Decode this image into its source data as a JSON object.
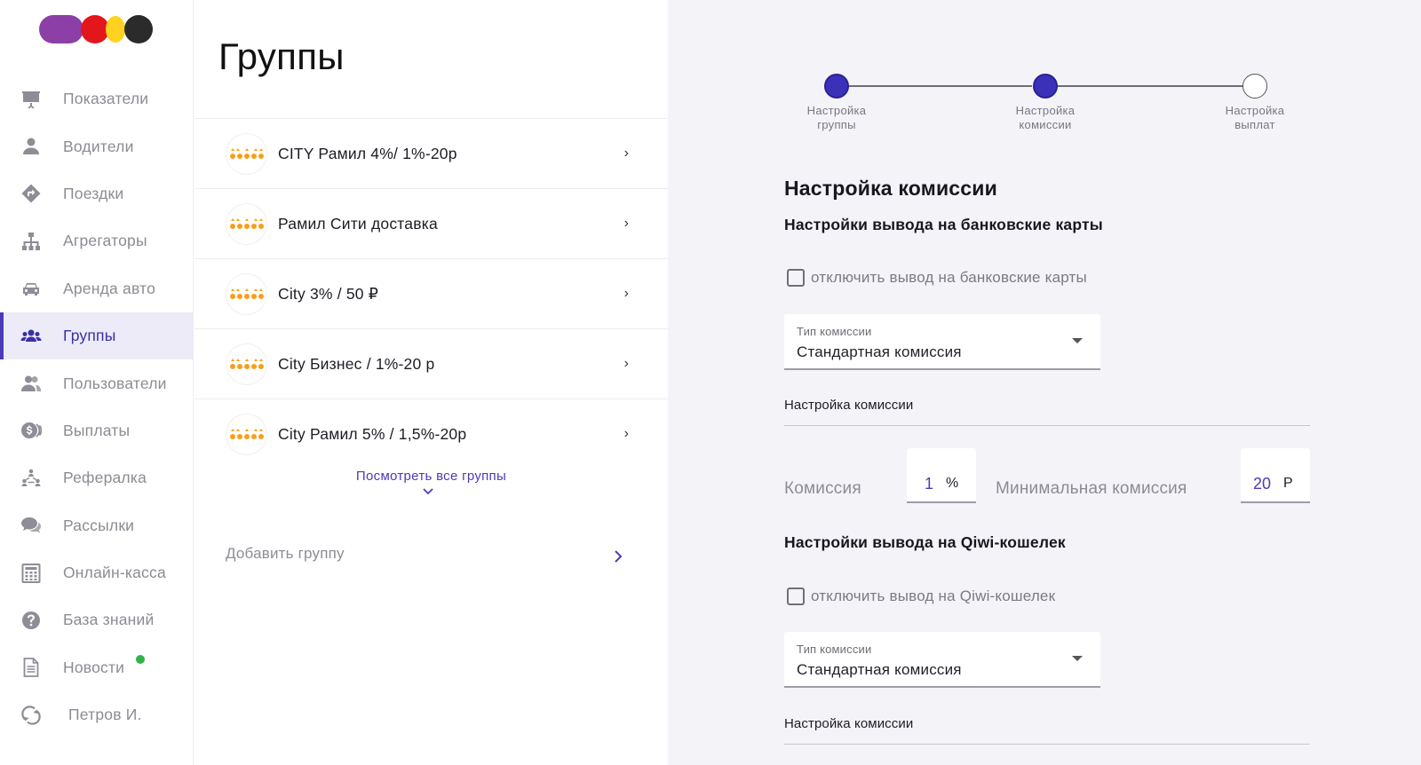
{
  "sidebar": {
    "items": [
      {
        "label": "Показатели",
        "icon": "chart-presentation-icon",
        "active": false
      },
      {
        "label": "Водители",
        "icon": "user-icon",
        "active": false
      },
      {
        "label": "Поездки",
        "icon": "route-sign-icon",
        "active": false
      },
      {
        "label": "Агрегаторы",
        "icon": "hierarchy-icon",
        "active": false
      },
      {
        "label": "Аренда авто",
        "icon": "car-icon",
        "active": false
      },
      {
        "label": "Группы",
        "icon": "group-icon",
        "active": true
      },
      {
        "label": "Пользователи",
        "icon": "users-icon",
        "active": false
      },
      {
        "label": "Выплаты",
        "icon": "coins-icon",
        "active": false
      },
      {
        "label": "Рефералка",
        "icon": "referral-icon",
        "active": false
      },
      {
        "label": "Рассылки",
        "icon": "chat-bubbles-icon",
        "active": false
      },
      {
        "label": "Онлайн-касса",
        "icon": "calculator-icon",
        "active": false
      },
      {
        "label": "База знаний",
        "icon": "help-circle-icon",
        "active": false
      },
      {
        "label": "Новости",
        "icon": "document-icon",
        "active": false,
        "badge_color": "#2fb34a"
      },
      {
        "label": "Петров И.",
        "icon": "sync-icon",
        "active": false
      }
    ]
  },
  "groups": {
    "title": "Группы",
    "items": [
      {
        "name": "CITY Рамил 4%/ 1%-20р"
      },
      {
        "name": "Рамил Сити доставка"
      },
      {
        "name": "City 3% / 50 ₽"
      },
      {
        "name": "City Бизнес / 1%-20 р"
      },
      {
        "name": "City Рамил 5% / 1,5%-20р"
      }
    ],
    "see_all": "Посмотреть все группы",
    "add_group": "Добавить группу"
  },
  "stepper": {
    "steps": [
      {
        "label": "Настройка\nгруппы",
        "state": "done"
      },
      {
        "label": "Настройка\nкомиссии",
        "state": "done"
      },
      {
        "label": "Настройка\nвыплат",
        "state": "todo"
      }
    ],
    "accent": "#3b30b8"
  },
  "settings": {
    "title": "Настройка комиссии",
    "bank": {
      "heading": "Настройки вывода на банковские карты",
      "checkbox_label": "отключить вывод на банковские карты",
      "select_caption": "Тип комиссии",
      "select_value": "Стандартная комиссия",
      "section_title": "Настройка комиссии",
      "commission_label": "Комиссия",
      "commission_value": "1",
      "commission_unit": "%",
      "min_label": "Минимальная комиссия",
      "min_value": "20",
      "min_unit": "Р"
    },
    "qiwi": {
      "heading": "Настройки вывода на Qiwi-кошелек",
      "checkbox_label": "отключить вывод на Qiwi-кошелек",
      "select_caption": "Тип комиссии",
      "select_value": "Стандартная комиссия",
      "section_title": "Настройка комиссии"
    }
  }
}
